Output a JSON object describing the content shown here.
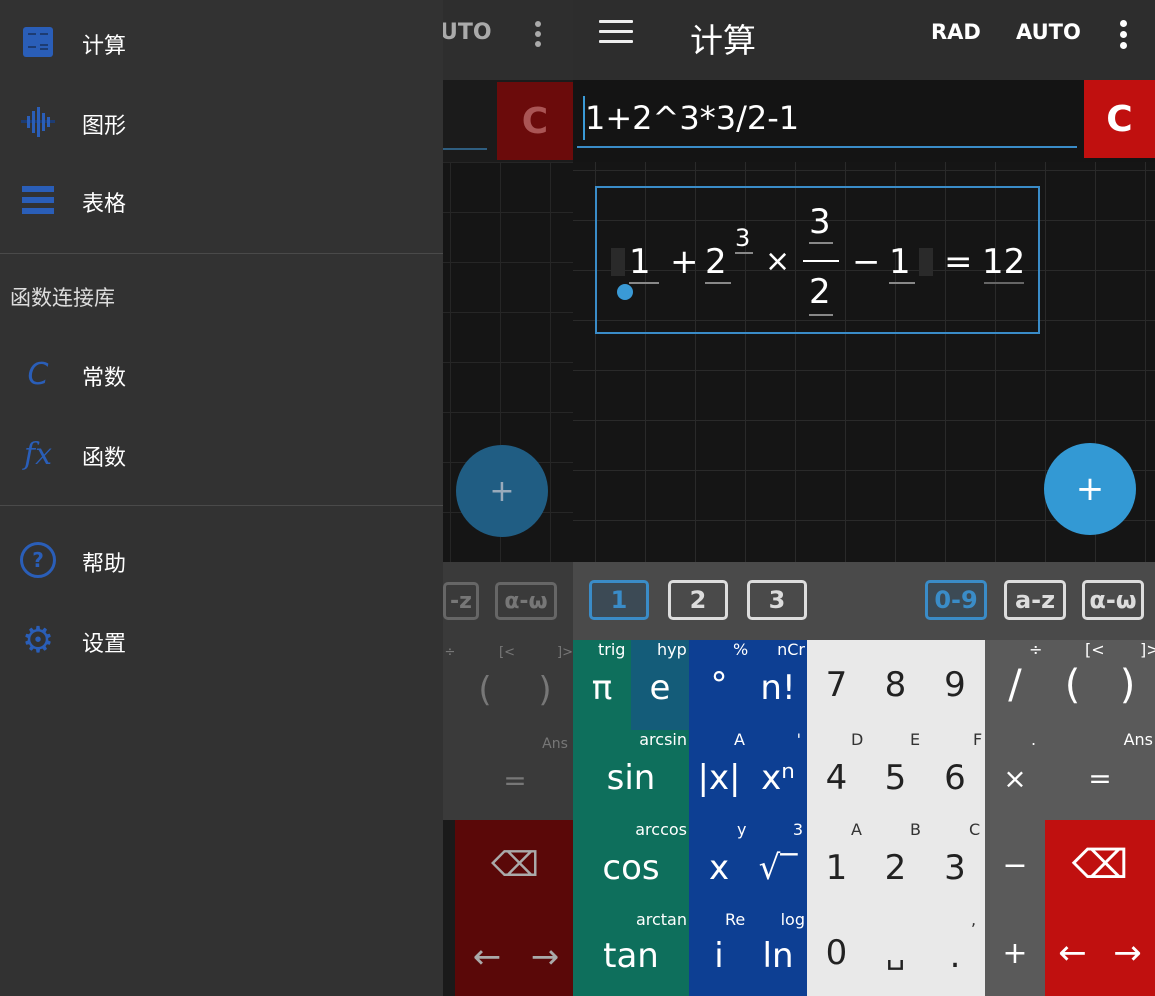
{
  "colors": {
    "accent": "#3a8cc8",
    "clear_red": "#c0100f",
    "trig_green": "#0e6f5c",
    "func_blue": "#0d3f93",
    "num_light": "#e9e9e9",
    "ops_gray": "#5a5a5a",
    "icon_blue": "#2a5eb8"
  },
  "drawer": {
    "items": [
      {
        "label": "计算",
        "icon": "calculator-icon"
      },
      {
        "label": "图形",
        "icon": "graph-icon"
      },
      {
        "label": "表格",
        "icon": "table-icon"
      }
    ],
    "section_label": "函数连接库",
    "library": [
      {
        "label": "常数",
        "icon": "constant-icon",
        "glyph": "C"
      },
      {
        "label": "函数",
        "icon": "function-icon",
        "glyph": "fx"
      }
    ],
    "bottom": [
      {
        "label": "帮助",
        "icon": "help-icon",
        "glyph": "?"
      },
      {
        "label": "设置",
        "icon": "settings-icon",
        "glyph": "⚙"
      }
    ]
  },
  "ghost": {
    "auto": "UTO",
    "clear": "C",
    "fab": "+",
    "tabs": [
      "-z",
      "α-ω"
    ],
    "keys": [
      "(",
      ")",
      "=",
      "Ans",
      "⌫",
      "←",
      "→",
      "÷",
      "[<",
      "]>"
    ]
  },
  "topbar": {
    "title": "计算",
    "rad": "RAD",
    "auto": "AUTO"
  },
  "input": {
    "value": "1+2^3*3/2-1",
    "clear": "C"
  },
  "result": {
    "n1": "1",
    "plus": "+",
    "base": "2",
    "exp": "3",
    "times": "×",
    "num": "3",
    "den": "2",
    "minus": "−",
    "n2": "1",
    "eq": "=",
    "value": "12"
  },
  "fab": "+",
  "tabs": {
    "left": [
      "1",
      "2",
      "3"
    ],
    "right": [
      "0-9",
      "a-z",
      "α-ω"
    ]
  },
  "keys": {
    "trig": [
      {
        "main": "π",
        "sup": "trig"
      },
      {
        "main": "e",
        "sup": "hyp"
      },
      {
        "main": "sin",
        "sup": "arcsin"
      },
      {
        "main": "cos",
        "sup": "arccos"
      },
      {
        "main": "tan",
        "sup": "arctan"
      }
    ],
    "func": [
      {
        "main": "°",
        "sup": "%"
      },
      {
        "main": "n!",
        "sup": "nCr"
      },
      {
        "main": "|x|",
        "sup": "A"
      },
      {
        "main": "xⁿ",
        "sup": "'"
      },
      {
        "main": "x",
        "sup": "y"
      },
      {
        "main": "√‾",
        "sup": "3"
      },
      {
        "main": "i",
        "sup": "Re"
      },
      {
        "main": "ln",
        "sup": "log"
      }
    ],
    "nums": [
      {
        "main": "7",
        "sup": ""
      },
      {
        "main": "8",
        "sup": ""
      },
      {
        "main": "9",
        "sup": ""
      },
      {
        "main": "4",
        "sup": "D"
      },
      {
        "main": "5",
        "sup": "E"
      },
      {
        "main": "6",
        "sup": "F"
      },
      {
        "main": "1",
        "sup": "A"
      },
      {
        "main": "2",
        "sup": "B"
      },
      {
        "main": "3",
        "sup": "C"
      },
      {
        "main": "0",
        "sup": ""
      },
      {
        "main": "␣",
        "sup": ""
      },
      {
        "main": ".",
        "sup": ","
      }
    ],
    "ops": {
      "divide": "/",
      "divide_sup": "÷",
      "lparen": "(",
      "lparen_sup": "[<",
      "rparen": ")",
      "rparen_sup": "]>",
      "times": "×",
      "times_sup": ".",
      "equals": "=",
      "equals_sup": "Ans",
      "minus": "−",
      "plus": "+",
      "backspace": "⌫",
      "left": "←",
      "right": "→"
    }
  }
}
